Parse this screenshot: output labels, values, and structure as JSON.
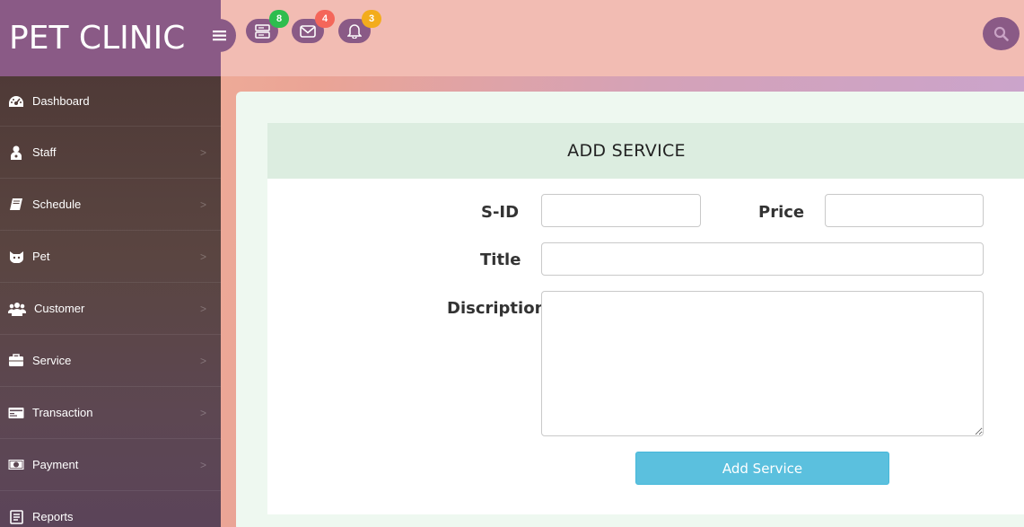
{
  "brand": {
    "title": "PET CLINIC"
  },
  "sidebar": {
    "items": [
      {
        "label": "Dashboard",
        "icon": "dashboard-icon"
      },
      {
        "label": "Staff",
        "icon": "staff-icon"
      },
      {
        "label": "Schedule",
        "icon": "book-icon"
      },
      {
        "label": "Pet",
        "icon": "pet-icon"
      },
      {
        "label": "Customer",
        "icon": "users-icon"
      },
      {
        "label": "Service",
        "icon": "briefcase-icon"
      },
      {
        "label": "Transaction",
        "icon": "credit-card-icon"
      },
      {
        "label": "Payment",
        "icon": "money-icon"
      },
      {
        "label": "Reports",
        "icon": "report-icon"
      }
    ]
  },
  "header": {
    "tasks_count": "8",
    "messages_count": "4",
    "notifications_count": "3",
    "colors": {
      "tasks_badge": "#2ebd4e",
      "messages_badge": "#f4665a",
      "notifications_badge": "#f3ac1c",
      "accent": "#8a5a86"
    }
  },
  "form": {
    "title": "ADD SERVICE",
    "sid_label": "S-ID",
    "price_label": "Price",
    "title_label": "Title",
    "description_label": "Discription",
    "sid_value": "",
    "price_value": "",
    "title_value": "",
    "description_value": "",
    "submit_label": "Add Service"
  }
}
